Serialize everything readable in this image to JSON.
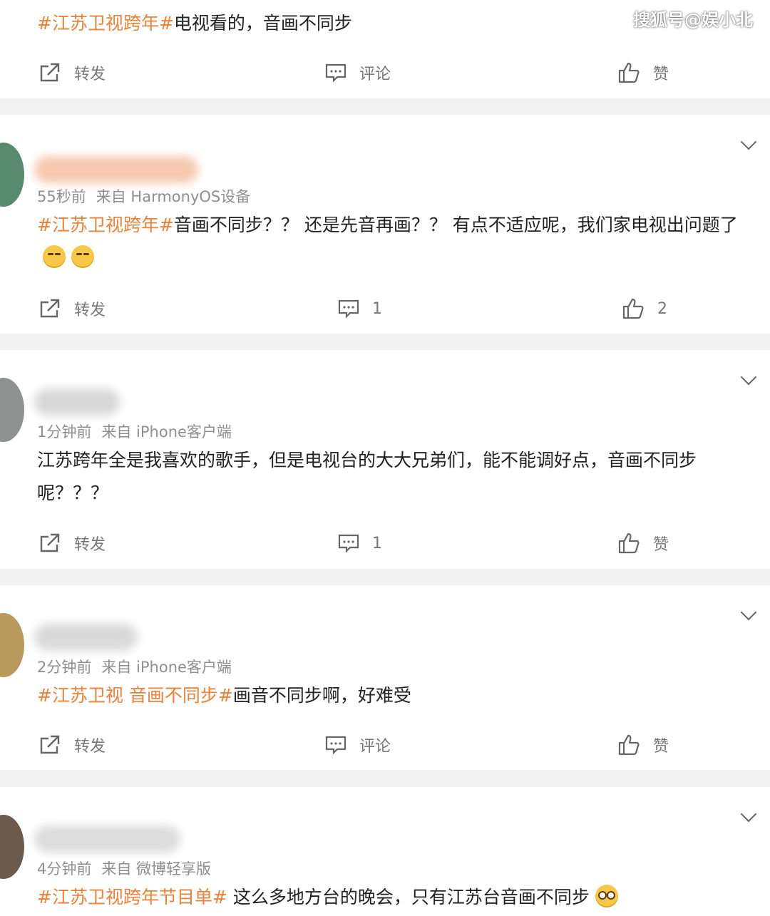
{
  "watermark": "搜狐号@娱小北",
  "actions_labels": {
    "repost": "转发",
    "comment": "评论",
    "like": "赞"
  },
  "posts": [
    {
      "body_tag": "#江苏卫视跨年#",
      "body_text": "电视看的，音画不同步",
      "comment_count": "评论",
      "like_count": "赞"
    },
    {
      "time": "55秒前",
      "source": "来自 HarmonyOS设备",
      "body_tag": "#江苏卫视跨年#",
      "body_text": "音画不同步？？ 还是先音再画？？ 有点不适应呢，我们家电视出问题了",
      "emoji_count": 2,
      "comment_count": "1",
      "like_count": "2"
    },
    {
      "time": "1分钟前",
      "source": "来自 iPhone客户端",
      "body_tag": "",
      "body_text": "江苏跨年全是我喜欢的歌手，但是电视台的大大兄弟们，能不能调好点，音画不同步呢？？？",
      "comment_count": "1",
      "like_count": "赞"
    },
    {
      "time": "2分钟前",
      "source": "来自 iPhone客户端",
      "body_tag": "#江苏卫视 音画不同步#",
      "body_text": "画音不同步啊，好难受",
      "comment_count": "评论",
      "like_count": "赞"
    },
    {
      "time": "4分钟前",
      "source": "来自 微博轻享版",
      "body_tag": "#江苏卫视跨年节目单#",
      "body_text": " 这么多地方台的晚会，只有江苏台音画不同步",
      "emoji_count": 1
    }
  ],
  "icons": [
    "repost-icon",
    "comment-icon",
    "like-icon",
    "chevron-down-icon"
  ],
  "colors": {
    "tag": "#e8823a",
    "meta": "#8f8f8f",
    "separator": "#f2f2f2"
  }
}
